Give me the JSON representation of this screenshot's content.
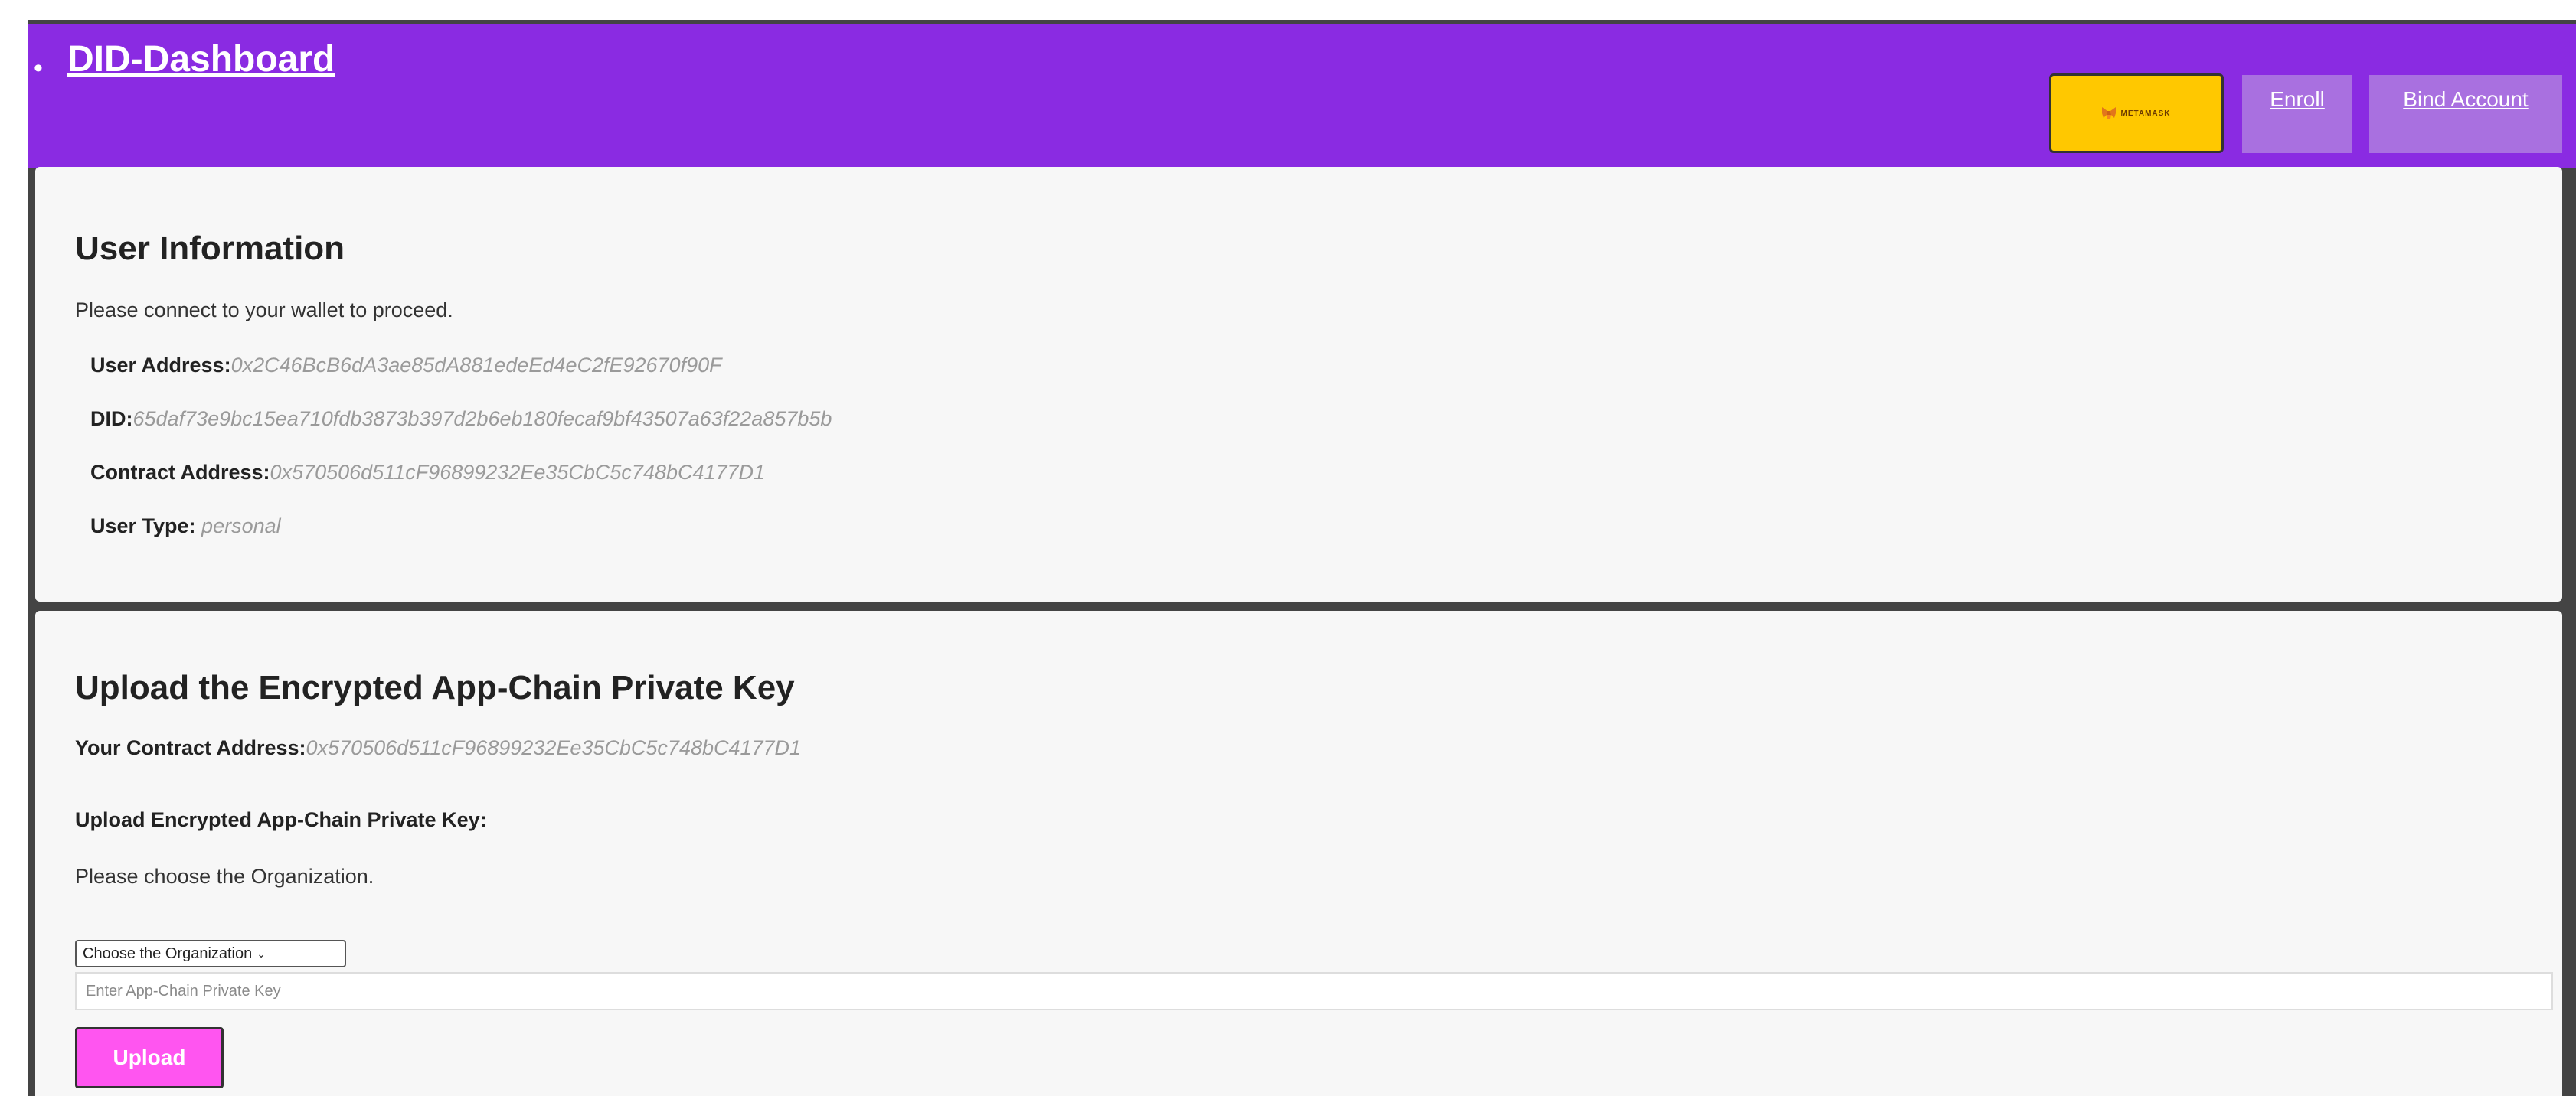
{
  "header": {
    "brand": "DID-Dashboard",
    "metamask_label": "METAMASK",
    "nav": {
      "enroll": "Enroll",
      "bind_account": "Bind Account"
    }
  },
  "colors": {
    "header_bg": "#8a2be2",
    "metamask_bg": "#ffc800",
    "nav_bg": "#a970e0",
    "upload_bg": "#ff55f0"
  },
  "user_info": {
    "title": "User Information",
    "prompt": "Please connect to your wallet to proceed.",
    "fields": [
      {
        "label": "User Address:",
        "value": "0x2C46BcB6dA3ae85dA881edeEd4eC2fE92670f90F"
      },
      {
        "label": "DID:",
        "value": "65daf73e9bc15ea710fdb3873b397d2b6eb180fecaf9bf43507a63f22a857b5b"
      },
      {
        "label": "Contract Address:",
        "value": "0x570506d511cF96899232Ee35CbC5c748bC4177D1"
      },
      {
        "label": "User Type: ",
        "value": "personal"
      }
    ]
  },
  "upload": {
    "title": "Upload the Encrypted App-Chain Private Key",
    "contract_label": "Your Contract Address:",
    "contract_value": "0x570506d511cF96899232Ee35CbC5c748bC4177D1",
    "section_label": "Upload Encrypted App-Chain Private Key:",
    "choose_prompt": "Please choose the Organization.",
    "org_select_value": "Choose the Organization",
    "key_placeholder": "Enter App-Chain Private Key",
    "upload_button": "Upload"
  },
  "icons": {
    "metamask": "metamask-fox-icon",
    "select": "chevron-down-icon"
  }
}
